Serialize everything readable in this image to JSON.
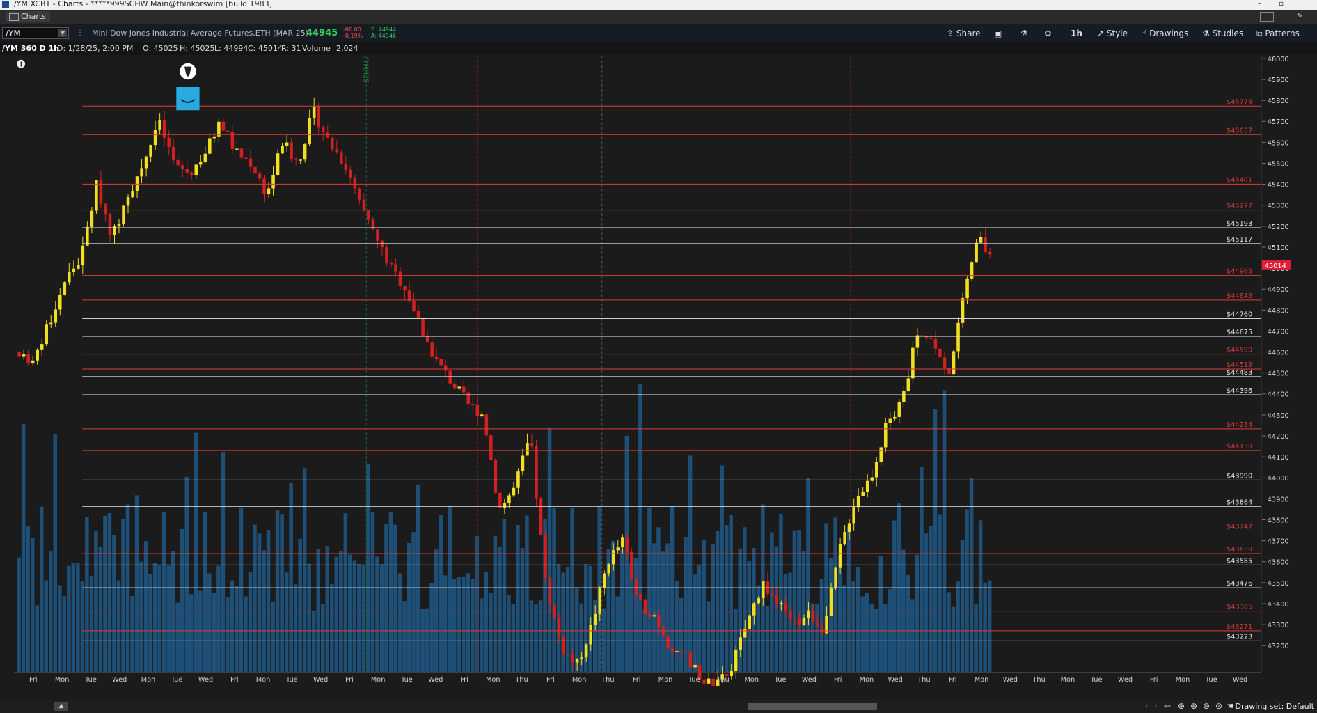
{
  "window": {
    "title": "/YM:XCBT - Charts - *****999SCHW Main@thinkorswim [build 1983]"
  },
  "tab": {
    "label": "Charts"
  },
  "toolbar": {
    "symbol": "/YM",
    "description": "Mini Dow Jones Industrial Average Futures,ETH (MAR 25)",
    "last": "44945",
    "change": "-86.00",
    "change_pct": "-0.19%",
    "bid": "B: 44944",
    "ask": "A: 44946",
    "buttons": {
      "share": "Share",
      "timeframe": "1h",
      "style": "Style",
      "drawings": "Drawings",
      "studies": "Studies",
      "patterns": "Patterns"
    }
  },
  "info": {
    "label": "/YM 360 D 1h",
    "date": "D: 1/28/25, 2:00 PM",
    "open": "O: 45025",
    "high": "H: 45025",
    "low": "L: 44994",
    "close": "C: 45014",
    "range": "R: 31",
    "volume_label": "Volume",
    "volume": "2,024"
  },
  "footer": {
    "drawing_set": "Drawing set: Default"
  },
  "chart_data": {
    "type": "candlestick",
    "price_axis": {
      "min": 43200,
      "max": 46000,
      "step": 100
    },
    "current_price": 45014,
    "expiry_label": "/YMH25",
    "x_tick_labels": [
      "Fri",
      "Mon",
      "Tue",
      "Wed",
      "Mon",
      "Tue",
      "Wed",
      "Fri",
      "Mon",
      "Tue",
      "Wed",
      "Fri",
      "Mon",
      "Tue",
      "Wed",
      "Fri",
      "Mon",
      "Thu",
      "Fri",
      "Mon",
      "Thu",
      "Fri",
      "Mon",
      "Tue",
      "Thu",
      "Mon",
      "Tue",
      "Wed",
      "Fri",
      "Mon",
      "Wed",
      "Thu",
      "Fri",
      "Mon",
      "Wed",
      "Thu",
      "Mon",
      "Tue",
      "Wed",
      "Fri",
      "Mon",
      "Tue",
      "Wed"
    ],
    "levels": [
      {
        "label": "$45773",
        "value": 45773,
        "color": "#e03a3a"
      },
      {
        "label": "$45637",
        "value": 45637,
        "color": "#e03a3a"
      },
      {
        "label": "$45401",
        "value": 45401,
        "color": "#e03a3a"
      },
      {
        "label": "$45277",
        "value": 45277,
        "color": "#e03a3a"
      },
      {
        "label": "$45193",
        "value": 45193,
        "color": "#e8e8e8"
      },
      {
        "label": "$45117",
        "value": 45117,
        "color": "#e8e8e8"
      },
      {
        "label": "$44965",
        "value": 44965,
        "color": "#e03a3a"
      },
      {
        "label": "$44848",
        "value": 44848,
        "color": "#e03a3a"
      },
      {
        "label": "$44760",
        "value": 44760,
        "color": "#e8e8e8"
      },
      {
        "label": "$44675",
        "value": 44675,
        "color": "#e8e8e8"
      },
      {
        "label": "$44590",
        "value": 44590,
        "color": "#e03a3a"
      },
      {
        "label": "$44519",
        "value": 44519,
        "color": "#e03a3a"
      },
      {
        "label": "$44483",
        "value": 44483,
        "color": "#e8e8e8"
      },
      {
        "label": "$44396",
        "value": 44396,
        "color": "#e8e8e8"
      },
      {
        "label": "$44234",
        "value": 44234,
        "color": "#e03a3a"
      },
      {
        "label": "$44130",
        "value": 44130,
        "color": "#e03a3a"
      },
      {
        "label": "$43990",
        "value": 43990,
        "color": "#e8e8e8"
      },
      {
        "label": "$43864",
        "value": 43864,
        "color": "#e8e8e8"
      },
      {
        "label": "$43747",
        "value": 43747,
        "color": "#e03a3a"
      },
      {
        "label": "$43639",
        "value": 43639,
        "color": "#e03a3a"
      },
      {
        "label": "$43585",
        "value": 43585,
        "color": "#e8e8e8"
      },
      {
        "label": "$43476",
        "value": 43476,
        "color": "#e8e8e8"
      },
      {
        "label": "$43365",
        "value": 43365,
        "color": "#e03a3a"
      },
      {
        "label": "$43271",
        "value": 43271,
        "color": "#e03a3a"
      },
      {
        "label": "$43223",
        "value": 43223,
        "color": "#e8e8e8"
      }
    ],
    "price_path": [
      44600,
      44550,
      44750,
      44950,
      45050,
      45400,
      45150,
      45350,
      45500,
      45700,
      45500,
      45450,
      45550,
      45700,
      45550,
      45500,
      45350,
      45600,
      45500,
      45750,
      45600,
      45500,
      45300,
      45150,
      45000,
      44900,
      44700,
      44550,
      44450,
      44350,
      44300,
      43850,
      43950,
      44200,
      43500,
      43200,
      43100,
      43300,
      43600,
      43700,
      43400,
      43350,
      43200,
      43150,
      43050,
      43000,
      43100,
      43300,
      43500,
      43400,
      43300,
      43350,
      43280,
      43650,
      43900,
      44000,
      44250,
      44350,
      44700,
      44650,
      44500,
      44850,
      45150,
      45000
    ]
  },
  "colors": {
    "bull": "#f0e020",
    "bear": "#d02020",
    "volume": "#1d4f77",
    "red_level": "#e03a3a",
    "white_level": "#e8e8e8",
    "accent_green": "#22c55e"
  }
}
